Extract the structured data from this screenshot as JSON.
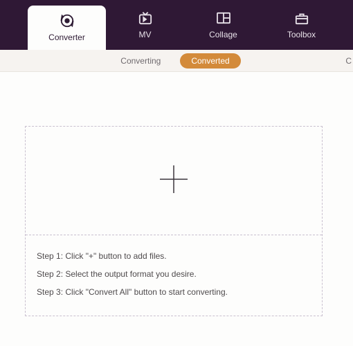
{
  "nav": {
    "tabs": [
      {
        "label": "Converter",
        "icon": "converter",
        "active": true
      },
      {
        "label": "MV",
        "icon": "mv",
        "active": false
      },
      {
        "label": "Collage",
        "icon": "collage",
        "active": false
      },
      {
        "label": "Toolbox",
        "icon": "toolbox",
        "active": false
      }
    ]
  },
  "subnav": {
    "tabs": [
      {
        "label": "Converting",
        "active": false
      },
      {
        "label": "Converted",
        "active": true
      }
    ],
    "partial_right": "C"
  },
  "dropzone": {
    "plus_aria": "Add files"
  },
  "instructions": {
    "step1": "Step 1: Click \"+\" button to add files.",
    "step2": "Step 2: Select the output format you desire.",
    "step3": "Step 3: Click \"Convert All\" button to start converting."
  }
}
